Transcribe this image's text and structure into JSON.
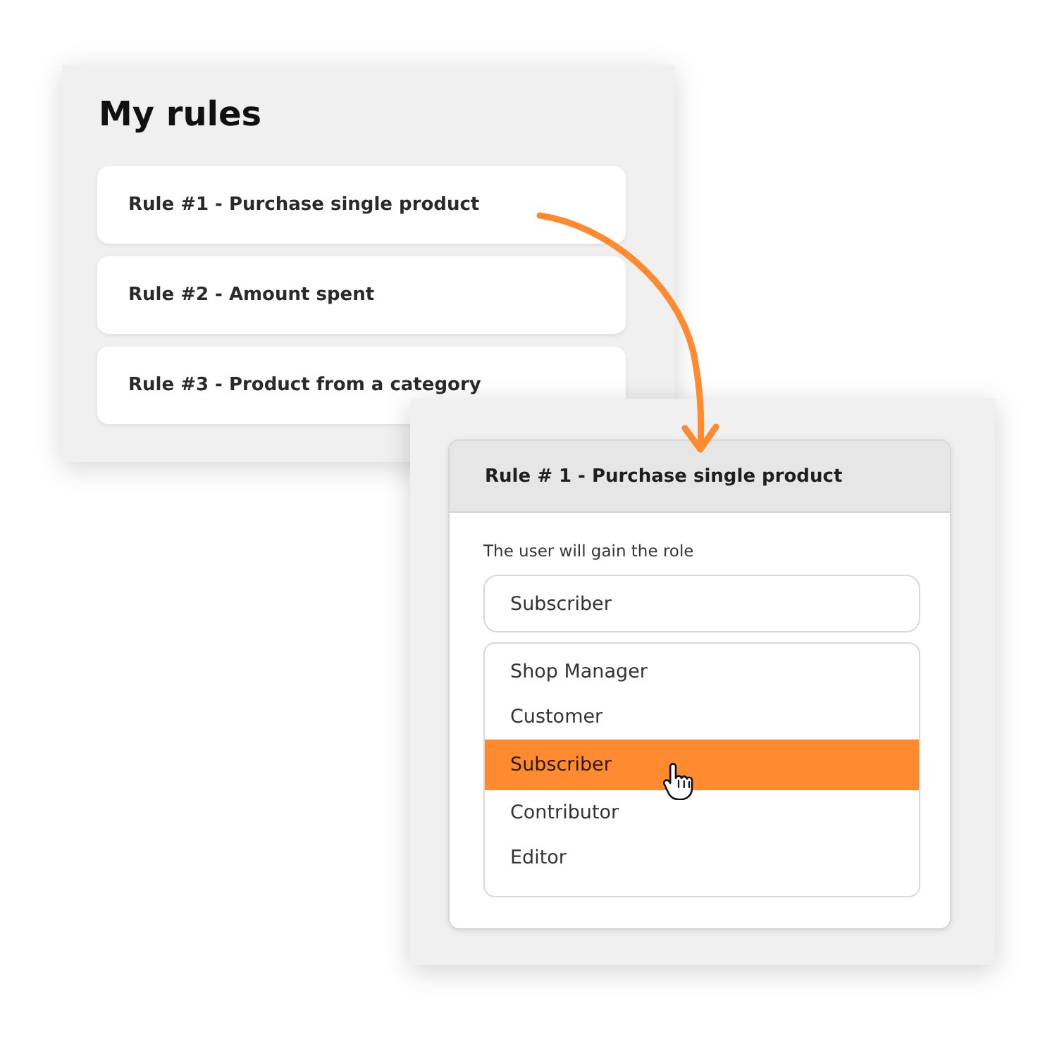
{
  "rules_panel": {
    "title": "My rules",
    "rules": [
      {
        "label": "Rule #1 - Purchase single product"
      },
      {
        "label": "Rule #2 - Amount spent"
      },
      {
        "label": "Rule #3 - Product from a category"
      }
    ]
  },
  "rule_editor": {
    "title": "Rule # 1 - Purchase single product",
    "field_label": "The user will gain the role",
    "role_select": {
      "value": "Subscriber"
    },
    "role_options": [
      {
        "label": "Shop Manager",
        "selected": false
      },
      {
        "label": "Customer",
        "selected": false
      },
      {
        "label": "Subscriber",
        "selected": true
      },
      {
        "label": "Contributor",
        "selected": false
      },
      {
        "label": "Editor",
        "selected": false
      }
    ]
  }
}
